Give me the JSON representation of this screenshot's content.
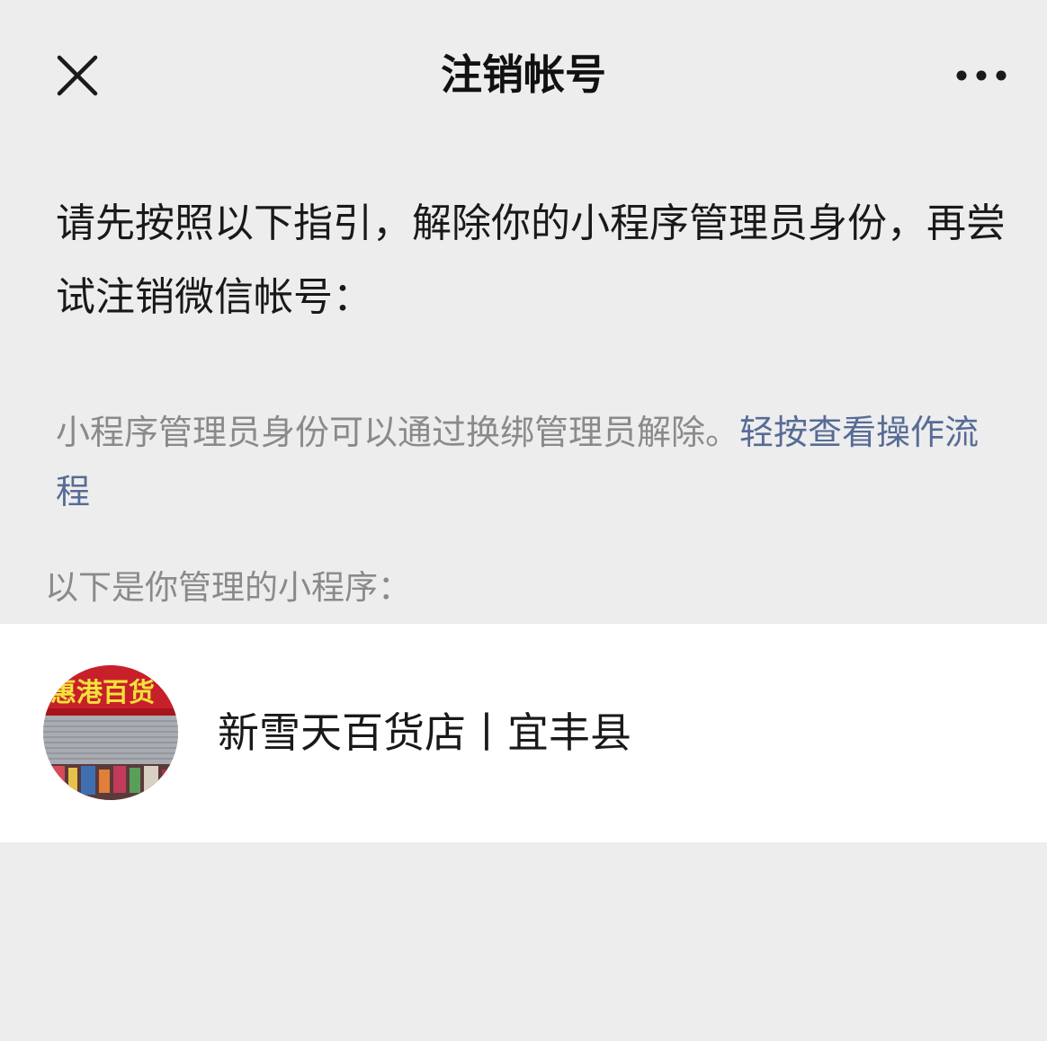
{
  "nav": {
    "title": "注销帐号",
    "close_icon": "close-icon",
    "more_icon": "more-icon"
  },
  "instruction": "请先按照以下指引，解除你的小程序管理员身份，再尝试注销微信帐号：",
  "hint": {
    "text": "小程序管理员身份可以通过换绑管理员解除。",
    "link": "轻按查看操作流程"
  },
  "section_label": "以下是你管理的小程序：",
  "mini_programs": [
    {
      "name": "新雪天百货店丨宜丰县",
      "avatar_sign_text": "惠港百货",
      "avatar_icon": "store-front-avatar"
    }
  ],
  "colors": {
    "background": "#ededed",
    "card": "#ffffff",
    "text_primary": "#191919",
    "text_secondary": "#8a8a8a",
    "link": "#576b95"
  }
}
